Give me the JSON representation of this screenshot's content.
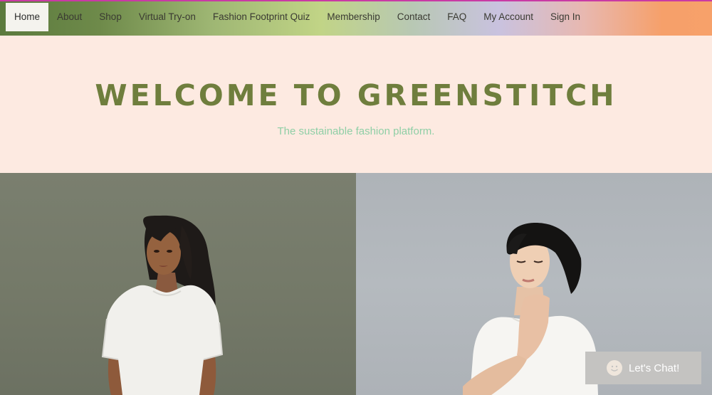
{
  "nav": {
    "items": [
      {
        "label": "Home"
      },
      {
        "label": "About"
      },
      {
        "label": "Shop"
      },
      {
        "label": "Virtual Try-on"
      },
      {
        "label": "Fashion Footprint Quiz"
      },
      {
        "label": "Membership"
      },
      {
        "label": "Contact"
      },
      {
        "label": "FAQ"
      },
      {
        "label": "My Account"
      },
      {
        "label": "Sign In"
      }
    ],
    "active": "Home"
  },
  "hero": {
    "title": "WELCOME TO GREENSTITCH",
    "subtitle": "The sustainable fashion platform."
  },
  "chat": {
    "label": "Let's Chat!",
    "icon": "smiley-icon"
  },
  "colors": {
    "title": "#6f7e3d",
    "subtitle": "#8fcfa6",
    "hero_bg": "#fdeae1",
    "chat_bg": "#c4c3c1"
  }
}
